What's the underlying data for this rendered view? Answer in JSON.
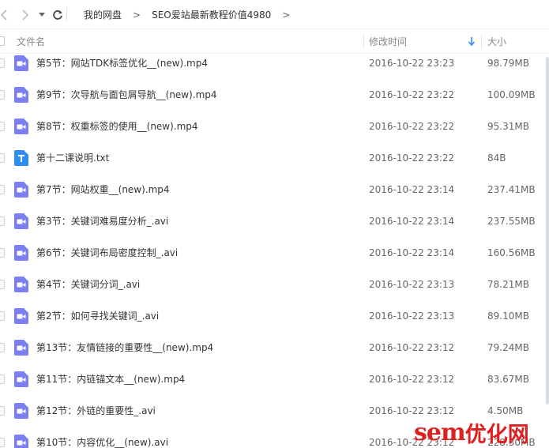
{
  "breadcrumb": {
    "root": "我的网盘",
    "current": "SEO爱站最新教程价值4980",
    "separator": ">"
  },
  "columns": {
    "name": "文件名",
    "modified": "修改时间",
    "size": "大小"
  },
  "files": [
    {
      "name": "第5节：网站TDK标签优化__(new).mp4",
      "type": "video",
      "modified": "2016-10-22 23:23",
      "size": "98.79MB"
    },
    {
      "name": "第9节：次导航与面包屑导航__(new).mp4",
      "type": "video",
      "modified": "2016-10-22 23:22",
      "size": "100.09MB"
    },
    {
      "name": "第8节：权重标签的使用__(new).mp4",
      "type": "video",
      "modified": "2016-10-22 23:22",
      "size": "95.31MB"
    },
    {
      "name": "第十二课说明.txt",
      "type": "text",
      "modified": "2016-10-22 23:22",
      "size": "84B"
    },
    {
      "name": "第7节：网站权重__(new).mp4",
      "type": "video",
      "modified": "2016-10-22 23:14",
      "size": "237.41MB"
    },
    {
      "name": "第3节：关键词难易度分析_.avi",
      "type": "video",
      "modified": "2016-10-22 23:14",
      "size": "237.55MB"
    },
    {
      "name": "第6节：关键词布局密度控制_.avi",
      "type": "video",
      "modified": "2016-10-22 23:14",
      "size": "160.56MB"
    },
    {
      "name": "第4节：关键词分词_.avi",
      "type": "video",
      "modified": "2016-10-22 23:13",
      "size": "78.21MB"
    },
    {
      "name": "第2节：如何寻找关键词_.avi",
      "type": "video",
      "modified": "2016-10-22 23:13",
      "size": "89.10MB"
    },
    {
      "name": "第13节：友情链接的重要性__(new).mp4",
      "type": "video",
      "modified": "2016-10-22 23:12",
      "size": "79.24MB"
    },
    {
      "name": "第11节：内链锚文本__(new).mp4",
      "type": "video",
      "modified": "2016-10-22 23:12",
      "size": "83.67MB"
    },
    {
      "name": "第12节：外链的重要性_.avi",
      "type": "video",
      "modified": "2016-10-22 23:12",
      "size": "4.50MB"
    },
    {
      "name": "第10节：内容优化__(new).avi",
      "type": "video",
      "modified": "2016-10-22 23:12",
      "size": "228.30MB"
    }
  ],
  "watermark": {
    "brand": "sem",
    "suffix": "优化网"
  },
  "colors": {
    "video_icon": "#7b80f0",
    "text_icon": "#2f8cf0",
    "sort_arrow": "#2f8cf0",
    "watermark": "#e02020"
  }
}
